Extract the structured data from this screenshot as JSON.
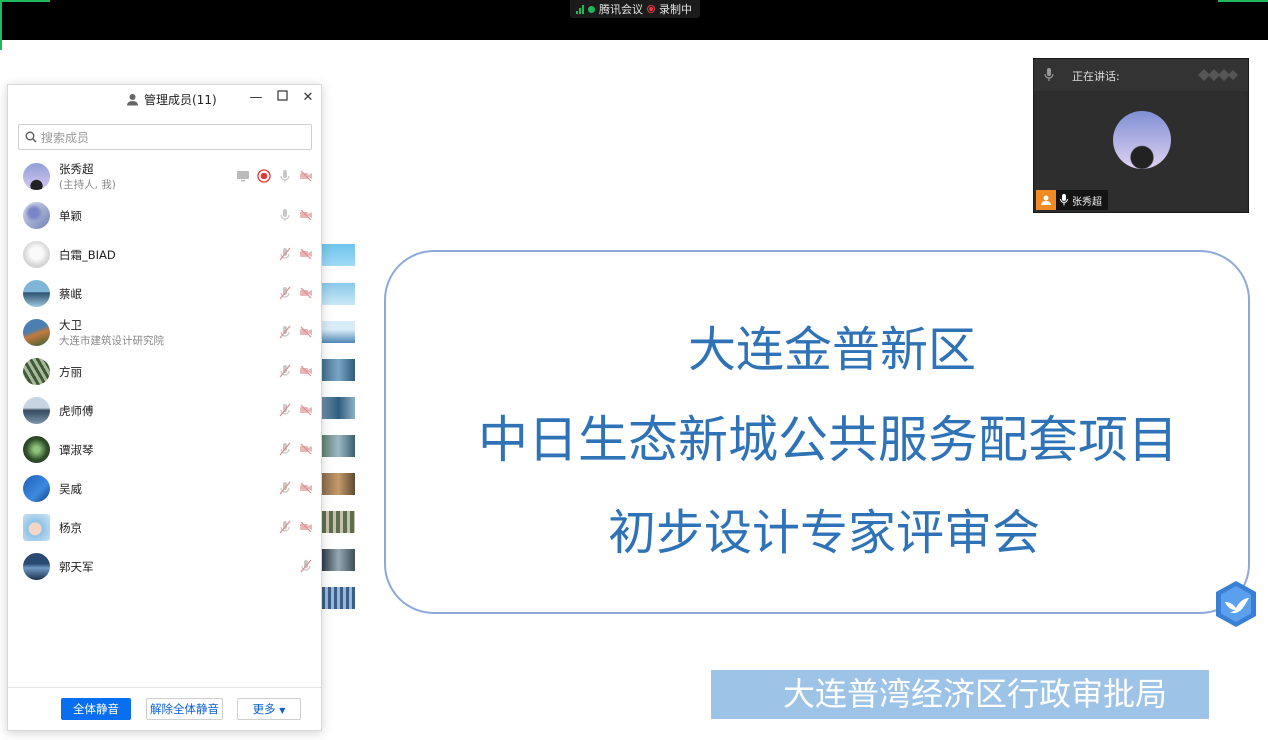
{
  "topbar": {
    "app_name": "腾讯会议",
    "recording_label": "录制中",
    "accent": "#1fb95a"
  },
  "panel": {
    "title": "管理成员(11)",
    "search_placeholder": "搜索成员",
    "members": [
      {
        "name": "张秀超",
        "sub": "(主持人, 我)"
      },
      {
        "name": "单颖",
        "sub": ""
      },
      {
        "name": "白霜_BIAD",
        "sub": ""
      },
      {
        "name": "蔡岷",
        "sub": ""
      },
      {
        "name": "大卫",
        "sub": "大连市建筑设计研究院"
      },
      {
        "name": "方丽",
        "sub": ""
      },
      {
        "name": "虎师傅",
        "sub": ""
      },
      {
        "name": "谭淑琴",
        "sub": ""
      },
      {
        "name": "吴威",
        "sub": ""
      },
      {
        "name": "杨京",
        "sub": ""
      },
      {
        "name": "郭天军",
        "sub": ""
      }
    ],
    "buttons": {
      "mute_all": "全体静音",
      "unmute_all": "解除全体静音",
      "more": "更多"
    }
  },
  "speaker": {
    "label": "正在讲话:",
    "name": "张秀超"
  },
  "slide": {
    "line1": "大连金普新区",
    "line2": "中日生态新城公共服务配套项目",
    "line3": "初步设计专家评审会",
    "footer": "大连普湾经济区行政审批局",
    "text_color": "#2f73b6",
    "border_color": "#8ea9d8",
    "banner_color": "#9dc3e7"
  }
}
